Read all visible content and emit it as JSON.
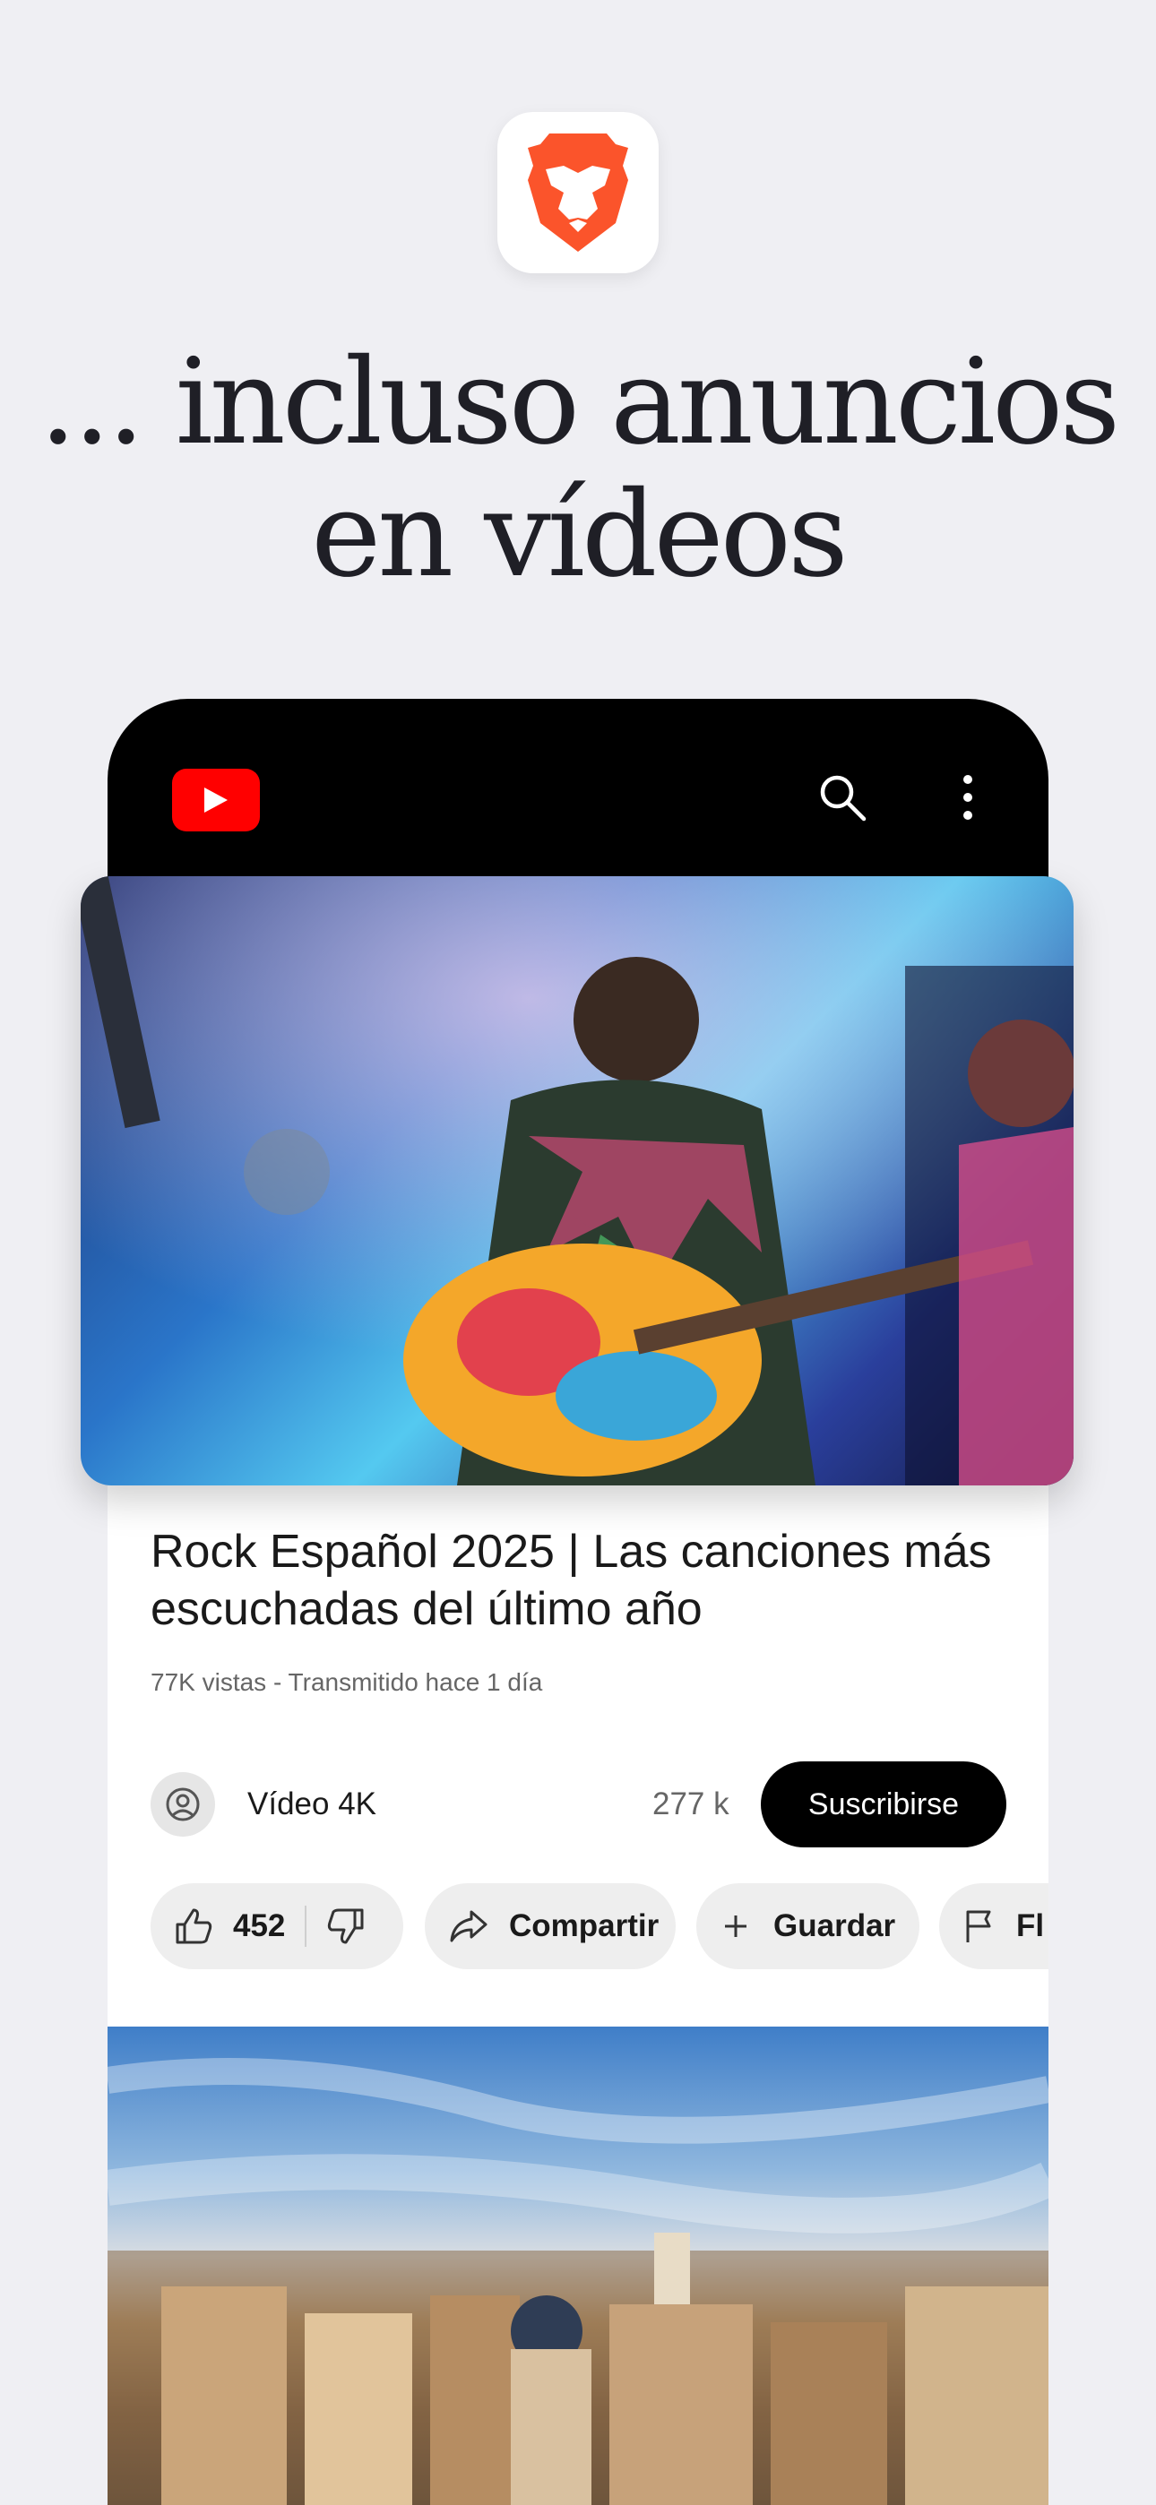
{
  "app": {
    "icon": "brave-lion-icon",
    "brand_color": "#fb542b"
  },
  "headline": {
    "line1": "... incluso anuncios",
    "line2": "en vídeos"
  },
  "youtube_bar": {
    "logo": "youtube-logo",
    "search_icon": "search-icon",
    "more_icon": "more-vertical-icon"
  },
  "video": {
    "title": "Rock Español 2025 | Las canciones más escuchadas del último año",
    "meta": "77K vistas - Transmitido hace 1 día",
    "channel_name": "Vídeo 4K",
    "subscriber_count": "277 k",
    "subscribe_label": "Suscribirse",
    "like_count": "452",
    "share_label": "Compartir",
    "save_label": "Guardar",
    "flag_label_partial": "Fl"
  },
  "colors": {
    "background": "#efeff3",
    "youtube_red": "#ff0000",
    "subscribe_bg": "#000000"
  }
}
